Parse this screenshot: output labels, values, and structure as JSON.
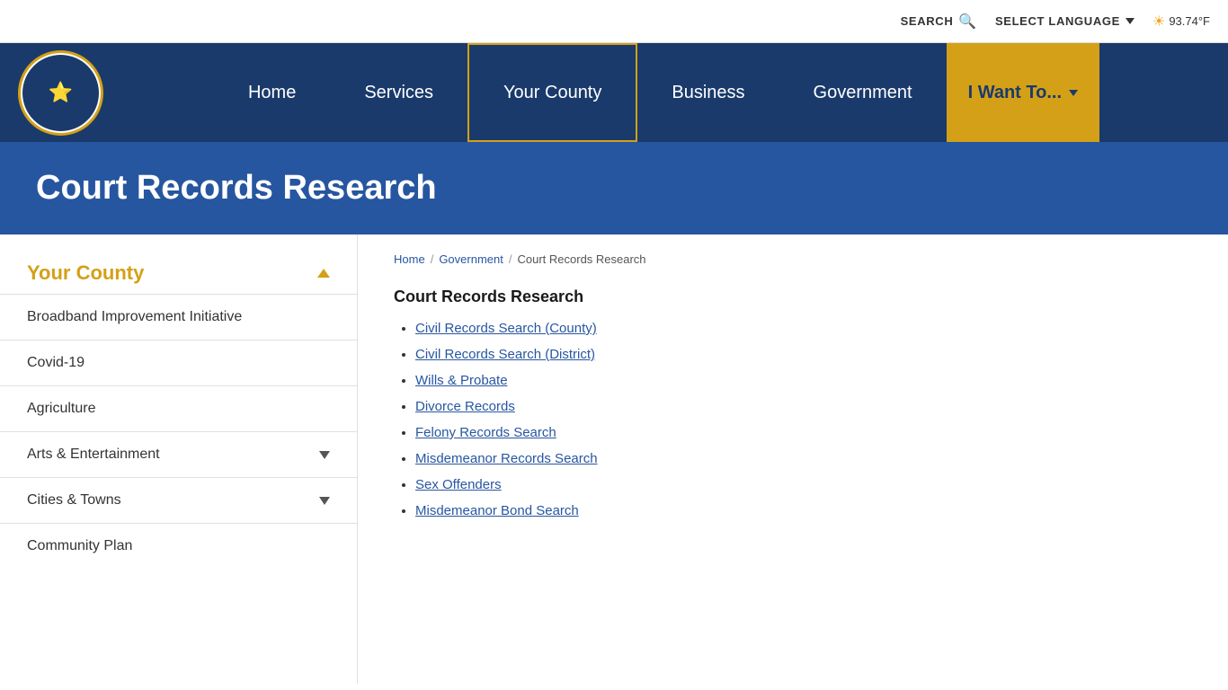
{
  "topbar": {
    "search_label": "SEARCH",
    "language_label": "SELECT LANGUAGE",
    "weather": "93.74°F"
  },
  "nav": {
    "home": "Home",
    "services": "Services",
    "your_county": "Your County",
    "business": "Business",
    "government": "Government",
    "i_want_to": "I Want To..."
  },
  "hero": {
    "title": "Court Records Research"
  },
  "sidebar": {
    "title": "Your County",
    "items": [
      {
        "label": "Broadband Improvement Initiative",
        "has_chevron": false
      },
      {
        "label": "Covid-19",
        "has_chevron": false
      },
      {
        "label": "Agriculture",
        "has_chevron": false
      },
      {
        "label": "Arts & Entertainment",
        "has_chevron": true
      },
      {
        "label": "Cities & Towns",
        "has_chevron": true
      },
      {
        "label": "Community Plan",
        "has_chevron": false
      }
    ]
  },
  "breadcrumb": {
    "home": "Home",
    "government": "Government",
    "current": "Court Records Research"
  },
  "content": {
    "title": "Court Records Research",
    "links": [
      {
        "label": "Civil Records Search (County)",
        "href": "#"
      },
      {
        "label": "Civil Records Search (District)",
        "href": "#"
      },
      {
        "label": "Wills & Probate",
        "href": "#"
      },
      {
        "label": "Divorce Records",
        "href": "#"
      },
      {
        "label": "Felony Records Search",
        "href": "#"
      },
      {
        "label": "Misdemeanor Records Search",
        "href": "#"
      },
      {
        "label": "Sex Offenders",
        "href": "#"
      },
      {
        "label": "Misdemeanor Bond Search",
        "href": "#"
      }
    ]
  }
}
